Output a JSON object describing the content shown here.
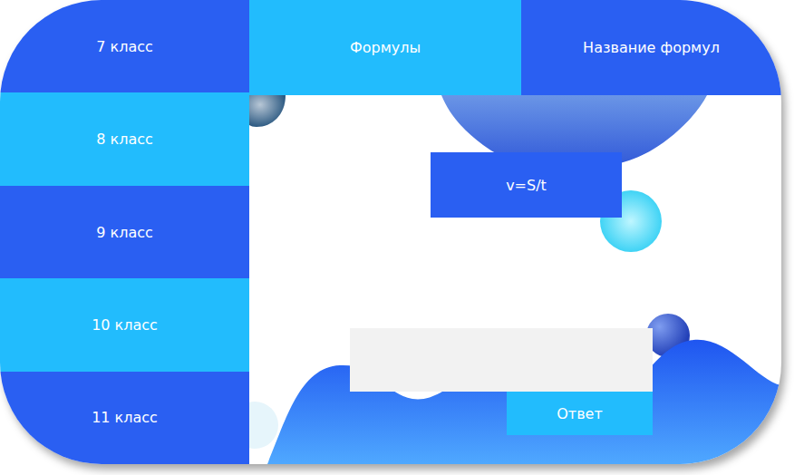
{
  "sidebar": {
    "items": [
      {
        "label": "7 класс"
      },
      {
        "label": "8 класс"
      },
      {
        "label": "9 класс"
      },
      {
        "label": "10 класс"
      },
      {
        "label": "11 класс"
      }
    ]
  },
  "header": {
    "tabs": [
      {
        "label": "Формулы"
      },
      {
        "label": "Название формул"
      }
    ]
  },
  "formula": "v=S/t",
  "answer": {
    "value": "",
    "button": "Ответ"
  }
}
